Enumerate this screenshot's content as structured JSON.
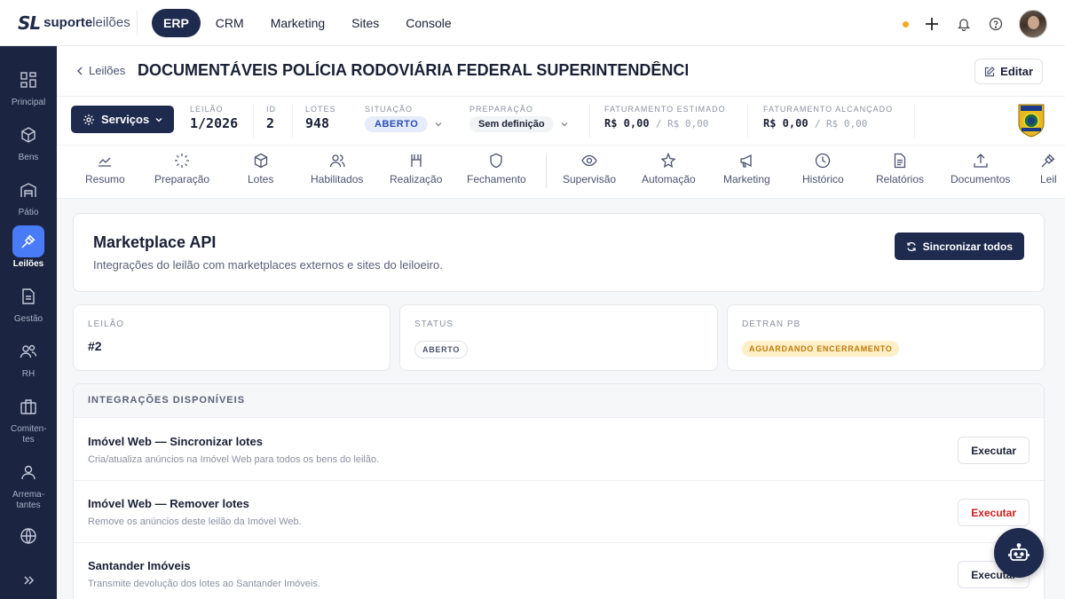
{
  "brand": {
    "mark": "SL",
    "name_bold": "suporte",
    "name_light": "leilões"
  },
  "topnav": [
    {
      "label": "ERP",
      "active": true
    },
    {
      "label": "CRM",
      "active": false
    },
    {
      "label": "Marketing",
      "active": false
    },
    {
      "label": "Sites",
      "active": false
    },
    {
      "label": "Console",
      "active": false
    }
  ],
  "status_dot_color": "#f5a623",
  "sidebar": [
    {
      "label": "Principal",
      "icon": "grid-icon"
    },
    {
      "label": "Bens",
      "icon": "box-icon"
    },
    {
      "label": "Pátio",
      "icon": "warehouse-icon"
    },
    {
      "label": "Leilões",
      "icon": "gavel-icon",
      "active": true
    },
    {
      "label": "Gestão",
      "icon": "document-icon"
    },
    {
      "label": "RH",
      "icon": "users-icon"
    },
    {
      "label": "Comiten-tes",
      "icon": "briefcase-icon"
    },
    {
      "label": "Arrema-tantes",
      "icon": "user-icon"
    },
    {
      "label": "",
      "icon": "globe-icon"
    }
  ],
  "header": {
    "back_label": "Leilões",
    "title": "DOCUMENTÁVEIS POLÍCIA RODOVIÁRIA FEDERAL SUPERINTENDÊNCI...",
    "edit_label": "Editar"
  },
  "infobar": {
    "services_label": "Serviços",
    "leilao": {
      "label": "LEILÃO",
      "value": "1/2026"
    },
    "id": {
      "label": "ID",
      "value": "2"
    },
    "lotes": {
      "label": "LOTES",
      "value": "948"
    },
    "situacao": {
      "label": "SITUAÇÃO",
      "value": "ABERTO"
    },
    "preparacao": {
      "label": "PREPARAÇÃO",
      "value": "Sem definição"
    },
    "fat_estimado": {
      "label": "FATURAMENTO ESTIMADO",
      "value": "R$ 0,00",
      "sub": "/ R$ 0,00"
    },
    "fat_alcancado": {
      "label": "FATURAMENTO ALCANÇADO",
      "value": "R$ 0,00",
      "sub": "/ R$ 0,00"
    }
  },
  "tabs": [
    {
      "label": "Resumo",
      "icon": "chart-line-icon"
    },
    {
      "label": "Preparação",
      "icon": "loader-icon"
    },
    {
      "label": "Lotes",
      "icon": "box-icon"
    },
    {
      "label": "Habilitados",
      "icon": "users-icon"
    },
    {
      "label": "Realização",
      "icon": "columns-icon"
    },
    {
      "label": "Fechamento",
      "icon": "shield-icon"
    },
    {
      "label": "Supervisão",
      "icon": "eye-icon"
    },
    {
      "label": "Automação",
      "icon": "sparkle-icon"
    },
    {
      "label": "Marketing",
      "icon": "megaphone-icon"
    },
    {
      "label": "Histórico",
      "icon": "clock-icon"
    },
    {
      "label": "Relatórios",
      "icon": "file-text-icon"
    },
    {
      "label": "Documentos",
      "icon": "upload-icon"
    },
    {
      "label": "Leil",
      "icon": "gavel-icon"
    }
  ],
  "marketplace": {
    "title": "Marketplace API",
    "subtitle": "Integrações do leilão com marketplaces externos e sites do leiloeiro.",
    "sync_label": "Sincronizar todos"
  },
  "summary": {
    "leilao": {
      "label": "LEILÃO",
      "value": "#2"
    },
    "status": {
      "label": "STATUS",
      "value": "ABERTO"
    },
    "detran": {
      "label": "DETRAN PB",
      "value": "AGUARDANDO ENCERRAMENTO"
    }
  },
  "integrations": {
    "heading": "INTEGRAÇÕES DISPONÍVEIS",
    "items": [
      {
        "name": "Imóvel Web — Sincronizar lotes",
        "desc": "Cria/atualiza anúncios na Imóvel Web para todos os bens do leilão.",
        "action": "Executar",
        "danger": false
      },
      {
        "name": "Imóvel Web — Remover lotes",
        "desc": "Remove os anúncios deste leilão da Imóvel Web.",
        "action": "Executar",
        "danger": true
      },
      {
        "name": "Santander Imóveis",
        "desc": "Transmite devolução dos lotes ao Santander Imóveis.",
        "action": "Executar",
        "danger": false
      }
    ]
  }
}
